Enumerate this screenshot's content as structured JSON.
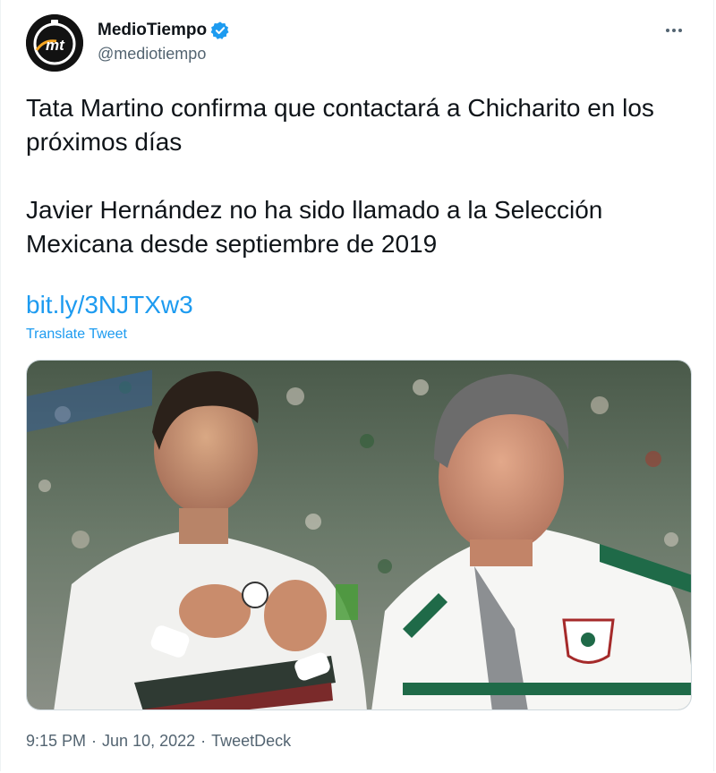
{
  "author": {
    "display_name": "MedioTiempo",
    "handle": "@mediotiempo",
    "avatar_icon": "mediotiempo-logo-icon",
    "verified_icon": "verified-badge-icon",
    "avatar_text": "mt"
  },
  "menu": {
    "icon": "more-options-icon"
  },
  "tweet": {
    "paragraph1": "Tata Martino confirma que contactará a Chicharito en los próximos días",
    "paragraph2": "Javier Hernández no ha sido llamado a la Selección Mexicana desde septiembre de 2019",
    "link": "bit.ly/3NJTXw3",
    "translate_label": "Translate Tweet"
  },
  "media": {
    "kind": "photo",
    "description": "two men, soccer player in white Mexico jersey and coach in white track jacket, stadium crowd background"
  },
  "meta": {
    "time": "9:15 PM",
    "date": "Jun 10, 2022",
    "separator": "·",
    "source": "TweetDeck"
  },
  "colors": {
    "link": "#1d9bf0",
    "secondary_text": "#536471",
    "primary_text": "#0f1419",
    "verified": "#1d9bf0"
  }
}
